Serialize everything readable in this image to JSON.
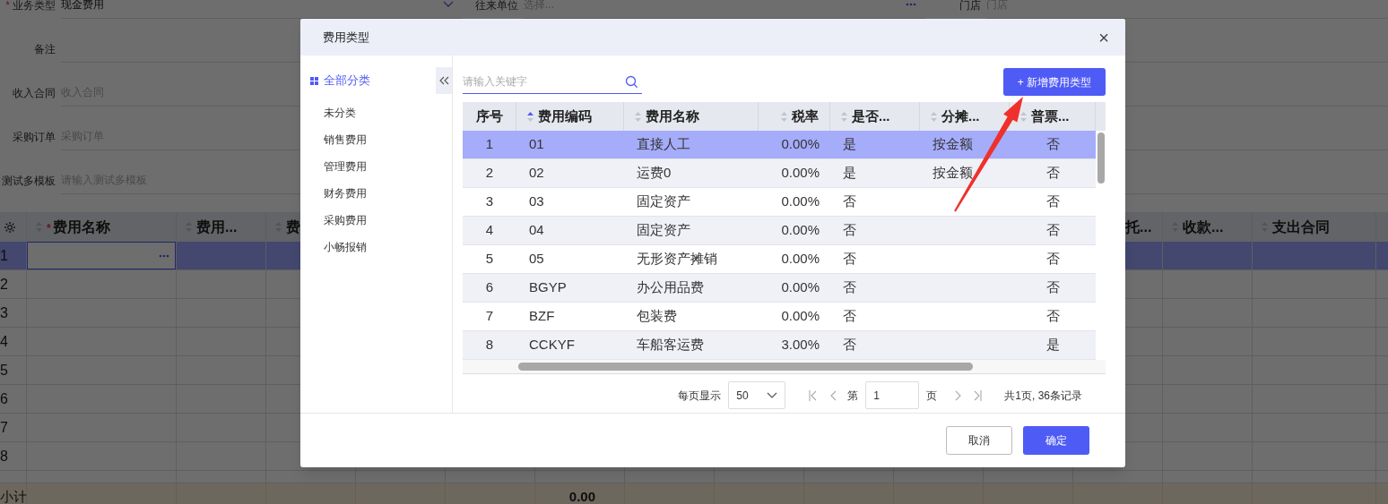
{
  "form": {
    "rows": [
      [
        {
          "label": "业务类型",
          "required_mark": "*",
          "kind": "select",
          "value": "现金费用"
        },
        {
          "label": "往来单位",
          "kind": "lookup",
          "placeholder": "选择..."
        },
        {
          "label": "门店",
          "kind": "text",
          "placeholder": "门店"
        }
      ],
      [
        {
          "label": "备注",
          "kind": "text"
        }
      ],
      [
        {
          "label": "收入合同",
          "kind": "text",
          "placeholder": "收入合同"
        }
      ],
      [
        {
          "label": "采购订单",
          "kind": "text",
          "placeholder": "采购订单"
        }
      ],
      [
        {
          "label": "测试多模板",
          "kind": "text",
          "placeholder": "请输入测试多模板"
        }
      ]
    ]
  },
  "grid": {
    "columns": [
      {
        "label": "费用名称",
        "required_mark": "*"
      },
      {
        "label": "费用..."
      },
      {
        "label": "费"
      },
      {
        "label": "托..."
      },
      {
        "label": "收款..."
      },
      {
        "label": "支出合同"
      }
    ],
    "rows": [
      {
        "number": "1",
        "selected": true
      },
      {
        "number": "2",
        "selected": false
      },
      {
        "number": "3",
        "selected": false
      },
      {
        "number": "4",
        "selected": false
      },
      {
        "number": "5",
        "selected": false
      },
      {
        "number": "6",
        "selected": false
      },
      {
        "number": "7",
        "selected": false
      },
      {
        "number": "8",
        "selected": false
      }
    ],
    "subtotal": {
      "label": "小计",
      "amount": "0.00"
    }
  },
  "dialog": {
    "title": "费用类型",
    "close": "×",
    "sidebar": {
      "items": [
        {
          "label": "全部分类",
          "selected": true
        },
        {
          "label": "未分类",
          "selected": false
        },
        {
          "label": "销售费用",
          "selected": false
        },
        {
          "label": "管理费用",
          "selected": false
        },
        {
          "label": "财务费用",
          "selected": false
        },
        {
          "label": "采购费用",
          "selected": false
        },
        {
          "label": "小畅报销",
          "selected": false
        }
      ]
    },
    "search": {
      "placeholder": "请输入关键字"
    },
    "add_button": "+ 新增费用类型",
    "table": {
      "columns": [
        {
          "label": "序号",
          "sortable": false
        },
        {
          "label": "费用编码",
          "sortable": true,
          "sorted_ascending": true
        },
        {
          "label": "费用名称",
          "sortable": true,
          "sorted_ascending": false
        },
        {
          "label": "税率",
          "sortable": true,
          "sorted_ascending": false
        },
        {
          "label": "是否...",
          "sortable": true,
          "sorted_ascending": false
        },
        {
          "label": "分摊...",
          "sortable": true,
          "sorted_ascending": false
        },
        {
          "label": "普票...",
          "sortable": true,
          "sorted_ascending": false
        }
      ],
      "rows": [
        {
          "cells": [
            "1",
            "01",
            "直接人工",
            "0.00%",
            "是",
            "按金额",
            "否"
          ],
          "selected": true
        },
        {
          "cells": [
            "2",
            "02",
            "运费0",
            "0.00%",
            "是",
            "按金额",
            "否"
          ],
          "selected": false
        },
        {
          "cells": [
            "3",
            "03",
            "固定资产",
            "0.00%",
            "否",
            "",
            "否"
          ],
          "selected": false
        },
        {
          "cells": [
            "4",
            "04",
            "固定资产",
            "0.00%",
            "否",
            "",
            "否"
          ],
          "selected": false
        },
        {
          "cells": [
            "5",
            "05",
            "无形资产摊销",
            "0.00%",
            "否",
            "",
            "否"
          ],
          "selected": false
        },
        {
          "cells": [
            "6",
            "BGYP",
            "办公用品费",
            "0.00%",
            "否",
            "",
            "否"
          ],
          "selected": false
        },
        {
          "cells": [
            "7",
            "BZF",
            "包装费",
            "0.00%",
            "否",
            "",
            "否"
          ],
          "selected": false
        },
        {
          "cells": [
            "8",
            "CCKYF",
            "车船客运费",
            "3.00%",
            "否",
            "",
            "是"
          ],
          "selected": false
        }
      ]
    },
    "pagination": {
      "page_size_label": "每页显示",
      "page_size": "50",
      "page_prefix": "第",
      "page": "1",
      "page_suffix": "页",
      "summary": "共1页, 36条记录"
    },
    "buttons": [
      {
        "label": "取消",
        "primary": false
      },
      {
        "label": "确定",
        "primary": true
      }
    ]
  }
}
